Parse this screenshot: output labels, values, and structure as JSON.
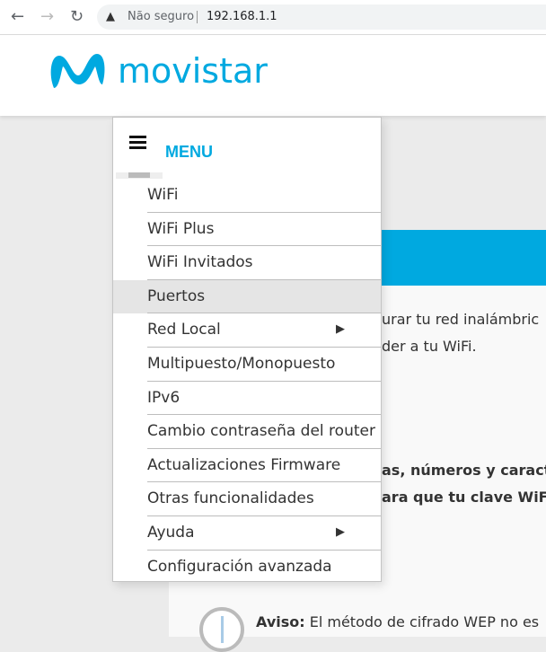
{
  "browser": {
    "security_label": "Não seguro",
    "url": "192.168.1.1"
  },
  "brand": {
    "name": "movistar",
    "color": "#00a9e0"
  },
  "menu": {
    "title": "MENU",
    "items": [
      {
        "label": "WiFi"
      },
      {
        "label": "WiFi Plus"
      },
      {
        "label": "WiFi Invitados"
      },
      {
        "label": "Puertos",
        "active": true
      },
      {
        "label": "Red Local",
        "submenu": true
      },
      {
        "label": "Multipuesto/Monopuesto"
      },
      {
        "label": "IPv6"
      },
      {
        "label": "Cambio contraseña del router"
      },
      {
        "label": "Actualizaciones Firmware"
      },
      {
        "label": "Otras funcionalidades"
      },
      {
        "label": "Ayuda",
        "submenu": true
      },
      {
        "label": "Configuración avanzada"
      }
    ]
  },
  "content": {
    "line1": "urar tu red inalámbric",
    "line2": "der a tu WiFi.",
    "bold1": "as, números y caracte",
    "bold2": "ara que tu clave WiFi t",
    "aviso_label": "Aviso:",
    "aviso_text": " El método de cifrado WEP no es"
  }
}
